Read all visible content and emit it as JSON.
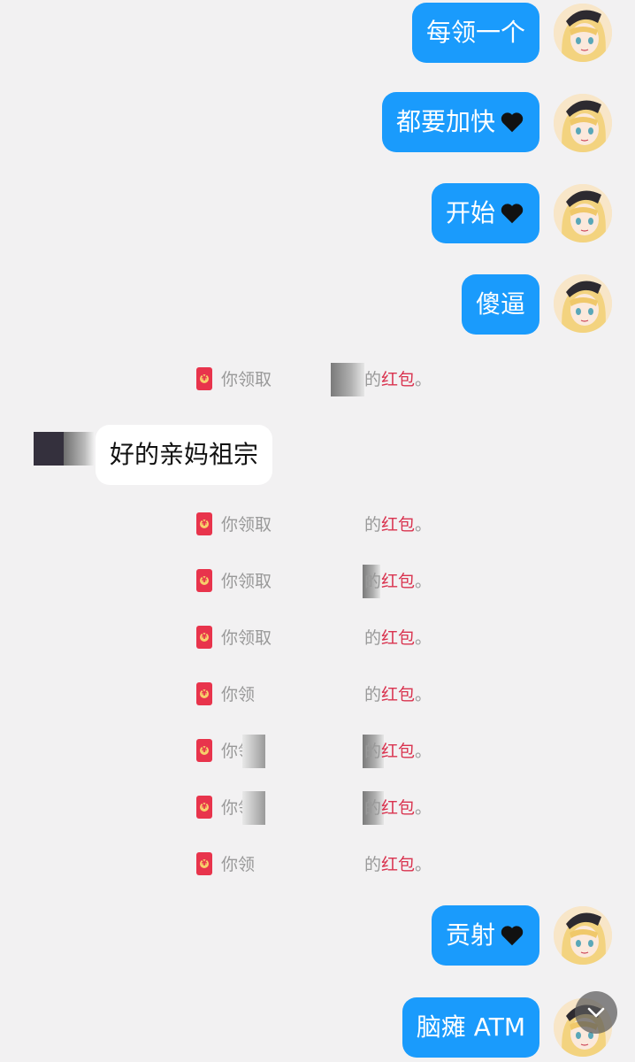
{
  "outgoing_top": [
    {
      "text": "每领一个",
      "heart": false
    },
    {
      "text": "都要加快",
      "heart": true
    },
    {
      "text": "开始",
      "heart": true
    },
    {
      "text": "傻逼",
      "heart": false
    }
  ],
  "incoming": {
    "text": "好的亲妈祖宗"
  },
  "notices": {
    "prefix": "你领取",
    "suffix_plain": "的",
    "suffix_highlight": "红包",
    "suffix_end": "。"
  },
  "outgoing_bottom": [
    {
      "text": "贡射",
      "heart": true
    },
    {
      "text": "脑瘫 ATM",
      "heart": false
    }
  ],
  "colors": {
    "bubble_out": "#1a9bfc",
    "bubble_in": "#ffffff",
    "background": "#f2f1f2",
    "red_packet": "#e8344c",
    "highlight": "#d9334f"
  },
  "icons": {
    "heart": "black-heart-icon",
    "packet": "red-packet-icon",
    "scroll": "chevron-down-icon"
  }
}
